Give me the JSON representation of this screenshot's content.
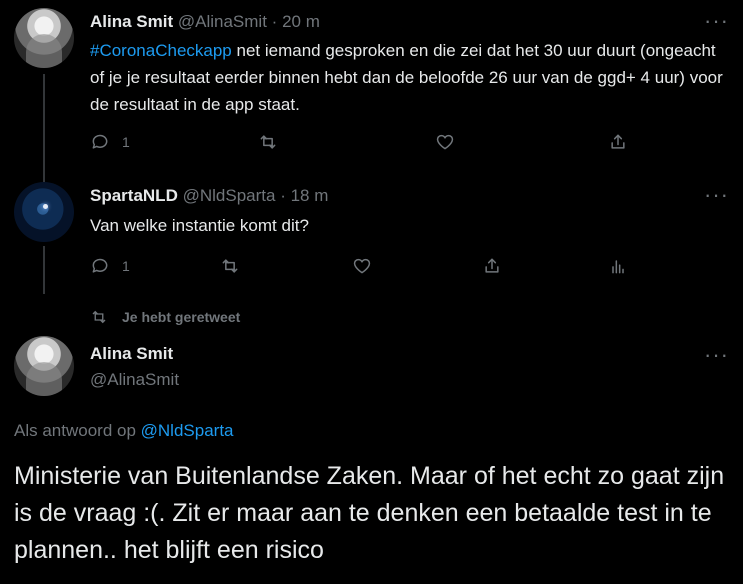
{
  "tweet1": {
    "name": "Alina Smit",
    "handle": "@AlinaSmit",
    "separator": "·",
    "time": "20 m",
    "hashtag": "#CoronaCheckapp",
    "text": " net iemand gesproken en die zei dat het 30 uur duurt (ongeacht of je je resultaat eerder binnen hebt dan de beloofde 26 uur van de ggd+ 4 uur) voor de resultaat in de app staat.",
    "reply_count": "1",
    "more_icon": "more-horizontal-icon"
  },
  "tweet2": {
    "name": "SpartaNLD",
    "handle": "@NldSparta",
    "separator": "·",
    "time": "18 m",
    "text": "Van welke instantie komt dit?",
    "reply_count": "1",
    "more_icon": "more-horizontal-icon"
  },
  "retweet_notice": {
    "label": "Je hebt geretweet"
  },
  "main_tweet": {
    "name": "Alina Smit",
    "handle": "@AlinaSmit",
    "reply_prefix": "Als antwoord op ",
    "reply_mention": "@NldSparta",
    "text": "Ministerie van Buitenlandse Zaken. Maar of het echt zo gaat zijn is de vraag :(. Zit er maar aan te denken een betaalde test in te plannen.. het blijft een risico"
  },
  "colors": {
    "background": "#000000",
    "accent": "#1d9bf0",
    "muted": "#71767b",
    "text": "#e7e9ea"
  }
}
